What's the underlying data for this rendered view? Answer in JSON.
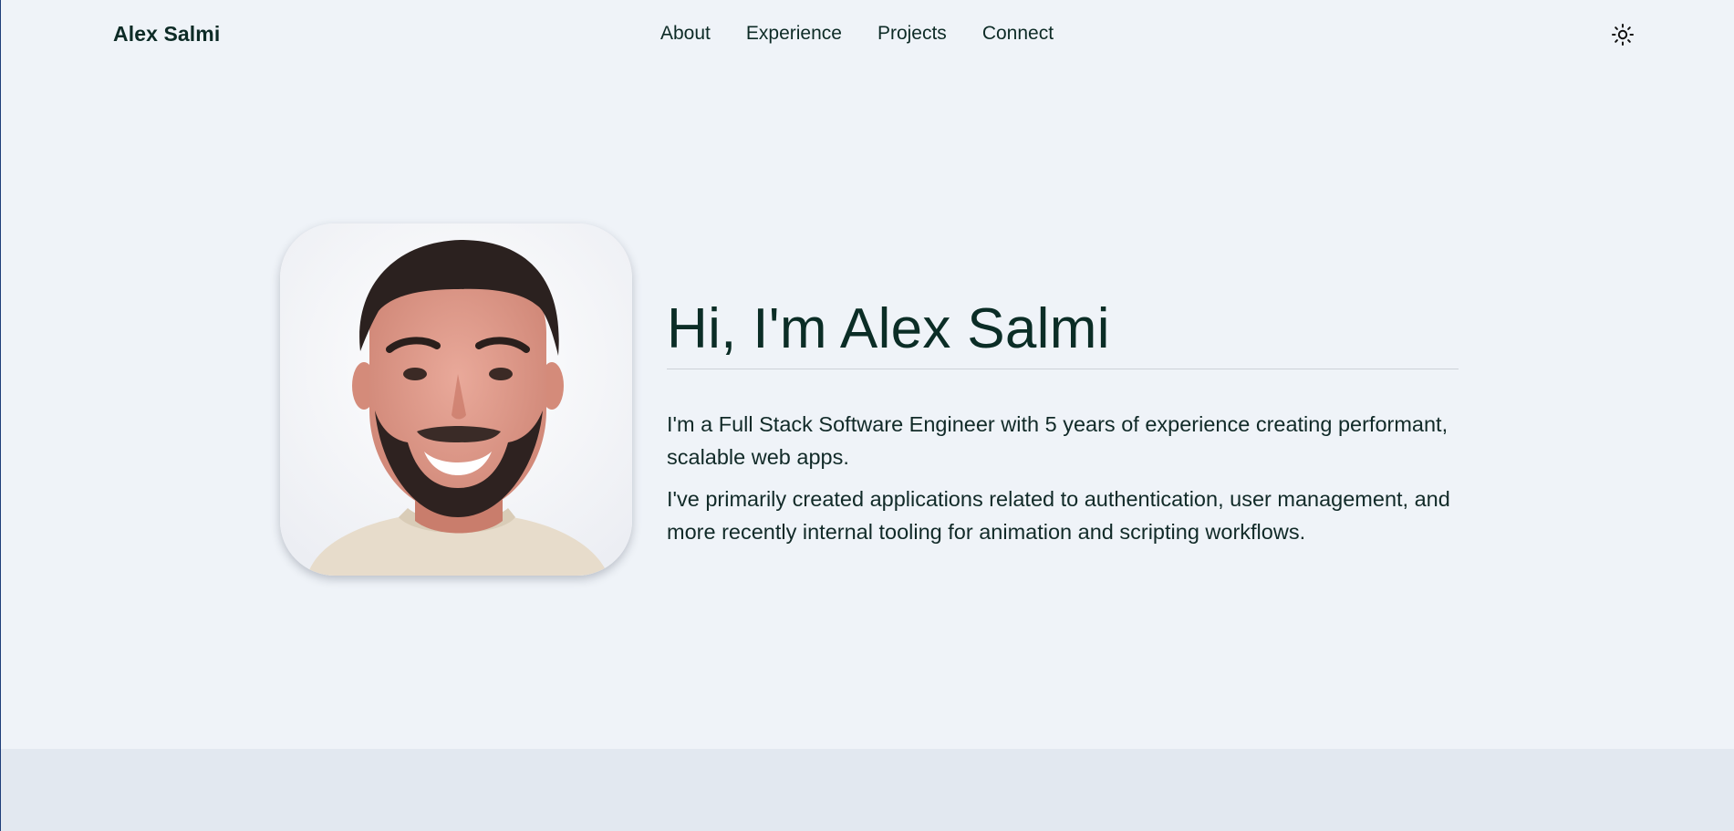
{
  "header": {
    "brand": "Alex Salmi",
    "nav": [
      "About",
      "Experience",
      "Projects",
      "Connect"
    ],
    "theme_icon": "sun-icon"
  },
  "hero": {
    "photo_alt": "Alex Salmi",
    "headline": "Hi, I'm Alex Salmi",
    "bio": [
      "I'm a Full Stack Software Engineer with 5 years of experience creating performant, scalable web apps.",
      "I've primarily created applications related to authentication, user management, and more recently internal tooling for animation and scripting workflows."
    ]
  },
  "colors": {
    "background": "#eff3f8",
    "text": "#0d2b26",
    "divider": "#cdd2d8",
    "footer_band": "#e2e8f0"
  }
}
